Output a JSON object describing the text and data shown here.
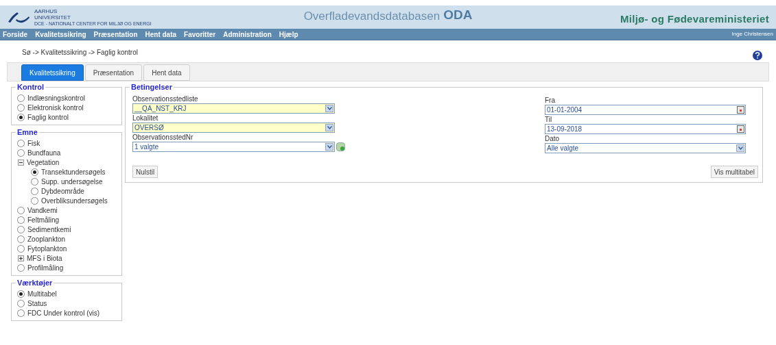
{
  "header": {
    "logo_lines": [
      "AARHUS",
      "UNIVERSITET",
      "DCE - NATIONALT CENTER FOR MILJØ OG ENERGI"
    ],
    "title": "Overfladevandsdatabasen",
    "title_bold": "ODA",
    "ministry": "Miljø- og Fødevareministeriet"
  },
  "menu": {
    "items": [
      "Forside",
      "Kvalitetssikring",
      "Præsentation",
      "Hent data",
      "Favoritter",
      "Administration",
      "Hjælp"
    ],
    "user": "Inge Christensen"
  },
  "breadcrumb": "Sø -> Kvalitetssikring -> Faglig kontrol",
  "tabs": [
    {
      "label": "Kvalitetssikring",
      "selected": true
    },
    {
      "label": "Præsentation",
      "selected": false
    },
    {
      "label": "Hent data",
      "selected": false
    }
  ],
  "kontrol": {
    "legend": "Kontrol",
    "items": [
      {
        "label": "Indlæsningskontrol",
        "selected": false
      },
      {
        "label": "Elektronisk kontrol",
        "selected": false
      },
      {
        "label": "Faglig kontrol",
        "selected": true
      }
    ]
  },
  "emne": {
    "legend": "Emne",
    "items": [
      {
        "kind": "radio",
        "label": "Fisk",
        "selected": false
      },
      {
        "kind": "radio",
        "label": "Bundfauna",
        "selected": false
      },
      {
        "kind": "group",
        "label": "Vegetation",
        "expanded": true,
        "children": [
          {
            "kind": "radio",
            "label": "Transektundersøgels",
            "selected": true
          },
          {
            "kind": "radio",
            "label": "Supp. undersøgelse",
            "selected": false
          },
          {
            "kind": "radio",
            "label": "Dybdeområde",
            "selected": false
          },
          {
            "kind": "radio",
            "label": "Overbliksundersøgels",
            "selected": false
          }
        ]
      },
      {
        "kind": "radio",
        "label": "Vandkemi",
        "selected": false
      },
      {
        "kind": "radio",
        "label": "Feltmåling",
        "selected": false
      },
      {
        "kind": "radio",
        "label": "Sedimentkemi",
        "selected": false
      },
      {
        "kind": "radio",
        "label": "Zooplankton",
        "selected": false
      },
      {
        "kind": "radio",
        "label": "Fytoplankton",
        "selected": false
      },
      {
        "kind": "group",
        "label": "MFS i Biota",
        "expanded": false
      },
      {
        "kind": "radio",
        "label": "Profilmåling",
        "selected": false
      }
    ]
  },
  "vaerktoejer": {
    "legend": "Værktøjer",
    "items": [
      {
        "label": "Multitabel",
        "selected": true
      },
      {
        "label": "Status",
        "selected": false
      },
      {
        "label": "FDC Under kontrol (vis)",
        "selected": false
      }
    ]
  },
  "betingelser": {
    "legend": "Betingelser",
    "left_fields": [
      {
        "kind": "select",
        "label": "Observationsstedliste",
        "value": "__QA_NST_KRJ",
        "highlighted": true,
        "add_button": false
      },
      {
        "kind": "select",
        "label": "Lokalitet",
        "value": "OVERSØ",
        "highlighted": true,
        "add_button": false
      },
      {
        "kind": "select",
        "label": "ObservationsstedNr",
        "value": "1 valgte",
        "highlighted": false,
        "add_button": true
      }
    ],
    "right_fields": [
      {
        "kind": "date",
        "label": "Fra",
        "value": "01-01-2004",
        "highlighted": false
      },
      {
        "kind": "date",
        "label": "Til",
        "value": "13-09-2018",
        "highlighted": false
      },
      {
        "kind": "select",
        "label": "Dato",
        "value": "Alle valgte",
        "highlighted": false
      }
    ],
    "reset_button": "Nulstil",
    "submit_button": "Vis multitabel"
  }
}
